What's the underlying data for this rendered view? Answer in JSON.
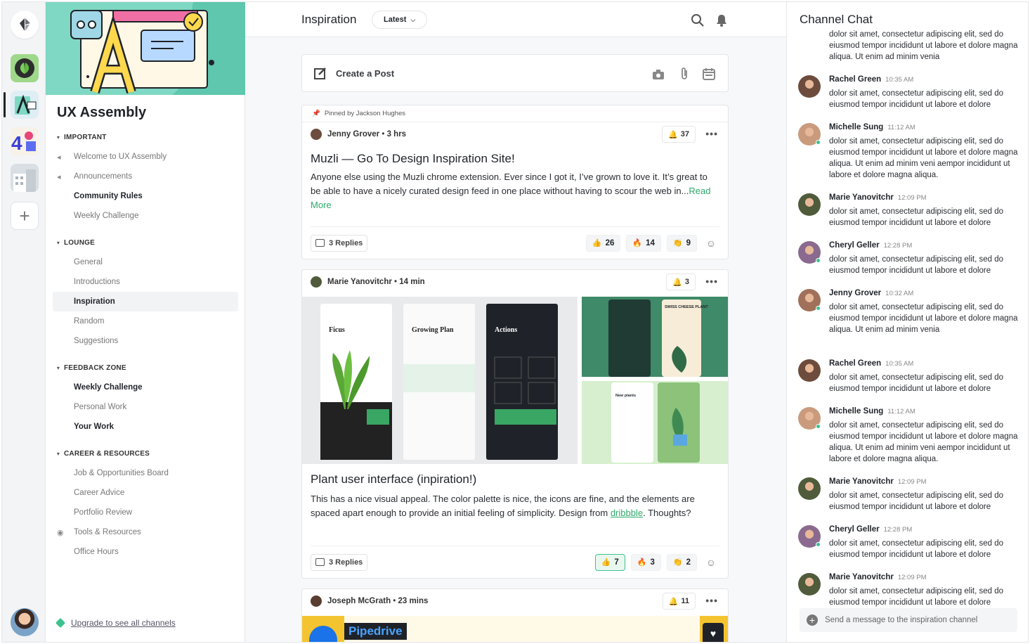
{
  "app": {
    "logo_icon": "community-logo-icon",
    "user_avatar": "user-avatar"
  },
  "rail": {
    "communities": [
      "plant-community",
      "ux-assembly",
      "art-community",
      "architecture-community"
    ],
    "add_icon": "plus-icon"
  },
  "channel_panel": {
    "community_name": "UX Assembly",
    "sections": [
      {
        "title": "IMPORTANT",
        "items": [
          {
            "label": "Welcome to UX Assembly",
            "icon": "megaphone-icon",
            "style": "muted"
          },
          {
            "label": "Announcements",
            "icon": "megaphone-icon",
            "style": "muted"
          },
          {
            "label": "Community Rules",
            "style": "bold"
          },
          {
            "label": "Weekly Challenge",
            "style": "muted"
          }
        ]
      },
      {
        "title": "LOUNGE",
        "items": [
          {
            "label": "General",
            "style": "muted"
          },
          {
            "label": "Introductions",
            "style": "muted"
          },
          {
            "label": "Inspiration",
            "style": "selected"
          },
          {
            "label": "Random",
            "style": "muted"
          },
          {
            "label": "Suggestions",
            "style": "muted"
          }
        ]
      },
      {
        "title": "FEEDBACK ZONE",
        "items": [
          {
            "label": "Weekly Challenge",
            "style": "bold"
          },
          {
            "label": "Personal Work",
            "style": "muted"
          },
          {
            "label": "Your Work",
            "style": "bold"
          }
        ]
      },
      {
        "title": "CAREER & RESOURCES",
        "items": [
          {
            "label": "Job & Opportunities Board",
            "style": "muted"
          },
          {
            "label": "Career Advice",
            "style": "muted"
          },
          {
            "label": "Portfolio Review",
            "style": "muted"
          },
          {
            "label": "Tools & Resources",
            "icon": "eye-icon",
            "style": "muted"
          },
          {
            "label": "Office Hours",
            "style": "muted"
          }
        ]
      }
    ],
    "upgrade_link": "Upgrade to see all channels"
  },
  "feed": {
    "title": "Inspiration",
    "sort": "Latest",
    "create_post": "Create a Post",
    "posts": [
      {
        "pinned": "Pinned by Jackson Hughes",
        "author": "Jenny Grover",
        "time": "3 hrs",
        "bell_count": "37",
        "title": "Muzli — Go To Design Inspiration Site!",
        "body": "Anyone else using the Muzli chrome extension. Ever since I got it, I’ve grown to love it. It’s great to be able to have a nicely curated design feed in one place without having to scour the web in...",
        "read_more": "Read More",
        "replies": "3 Replies",
        "reactions": [
          {
            "emoji": "👍",
            "count": "26"
          },
          {
            "emoji": "🔥",
            "count": "14"
          },
          {
            "emoji": "👏",
            "count": "9"
          }
        ]
      },
      {
        "author": "Marie Yanovitchr",
        "time": "14 min",
        "bell_count": "3",
        "gallery": {
          "screens": [
            "Ficus",
            "Growing Plan",
            "Actions"
          ],
          "side_a": "SWISS CHEESE PLANT",
          "side_b": "New plants"
        },
        "title": "Plant user interface (inpiration!)",
        "body_1": "This has a nice visual appeal. The color palette is nice, the icons are fine, and the elements are spaced apart enough to provide an initial feeling of simplicity. Design from ",
        "link": "dribbble",
        "body_2": ". Thoughts?",
        "replies": "3 Replies",
        "reactions": [
          {
            "emoji": "👍",
            "count": "7",
            "active": true
          },
          {
            "emoji": "🔥",
            "count": "3"
          },
          {
            "emoji": "👏",
            "count": "2"
          }
        ]
      },
      {
        "author": "Joseph McGrath",
        "time": "23 mins",
        "bell_count": "11",
        "preview_title": "Pipedrive"
      }
    ]
  },
  "chat": {
    "title": "Channel Chat",
    "top_fragment": "dolor sit amet, consectetur adipiscing elit, sed do eiusmod tempor incididunt ut labore et dolore magna aliqua. Ut enim ad minim venia",
    "messages": [
      {
        "name": "Rachel Green",
        "time": "10:35 AM",
        "text": "dolor sit amet, consectetur adipiscing elit, sed do eiusmod tempor incididunt ut labore et dolore",
        "online": false
      },
      {
        "name": "Michelle Sung",
        "time": "11:12 AM",
        "text": "dolor sit amet, consectetur adipiscing elit, sed do eiusmod tempor incididunt ut labore et dolore magna aliqua. Ut enim ad minim veni aempor incididunt ut labore et dolore magna aliqua.",
        "online": true
      },
      {
        "name": "Marie Yanovitchr",
        "time": "12:09 PM",
        "text": "dolor sit amet, consectetur adipiscing elit, sed do eiusmod tempor incididunt ut labore et dolore",
        "online": false
      },
      {
        "name": "Cheryl Geller",
        "time": "12:28 PM",
        "text": "dolor sit amet, consectetur adipiscing elit, sed do eiusmod tempor incididunt ut labore et dolore",
        "online": true
      },
      {
        "name": "Jenny Grover",
        "time": "10:32 AM",
        "text": "dolor sit amet, consectetur adipiscing elit, sed do eiusmod tempor incididunt ut labore et dolore magna aliqua. Ut enim ad minim venia",
        "online": true
      },
      {
        "name": "Rachel Green",
        "time": "10:35 AM",
        "text": "dolor sit amet, consectetur adipiscing elit, sed do eiusmod tempor incididunt ut labore et dolore",
        "online": false
      },
      {
        "name": "Michelle Sung",
        "time": "11:12 AM",
        "text": "dolor sit amet, consectetur adipiscing elit, sed do eiusmod tempor incididunt ut labore et dolore magna aliqua. Ut enim ad minim veni aempor incididunt ut labore et dolore magna aliqua.",
        "online": true
      },
      {
        "name": "Marie Yanovitchr",
        "time": "12:09 PM",
        "text": "dolor sit amet, consectetur adipiscing elit, sed do eiusmod tempor incididunt ut labore et dolore",
        "online": false
      },
      {
        "name": "Cheryl Geller",
        "time": "12:28 PM",
        "text": "dolor sit amet, consectetur adipiscing elit, sed do eiusmod tempor incididunt ut labore et dolore",
        "online": true
      },
      {
        "name": "Marie Yanovitchr",
        "time": "12:09 PM",
        "text": "dolor sit amet, consectetur adipiscing elit, sed do eiusmod tempor incididunt ut labore et dolore",
        "online": false
      }
    ],
    "input_placeholder": "Send a message to the inspiration channel"
  },
  "colors": {
    "accent_green": "#2daa6a",
    "banner": "#7fd8c3",
    "online": "#3cc28f"
  }
}
